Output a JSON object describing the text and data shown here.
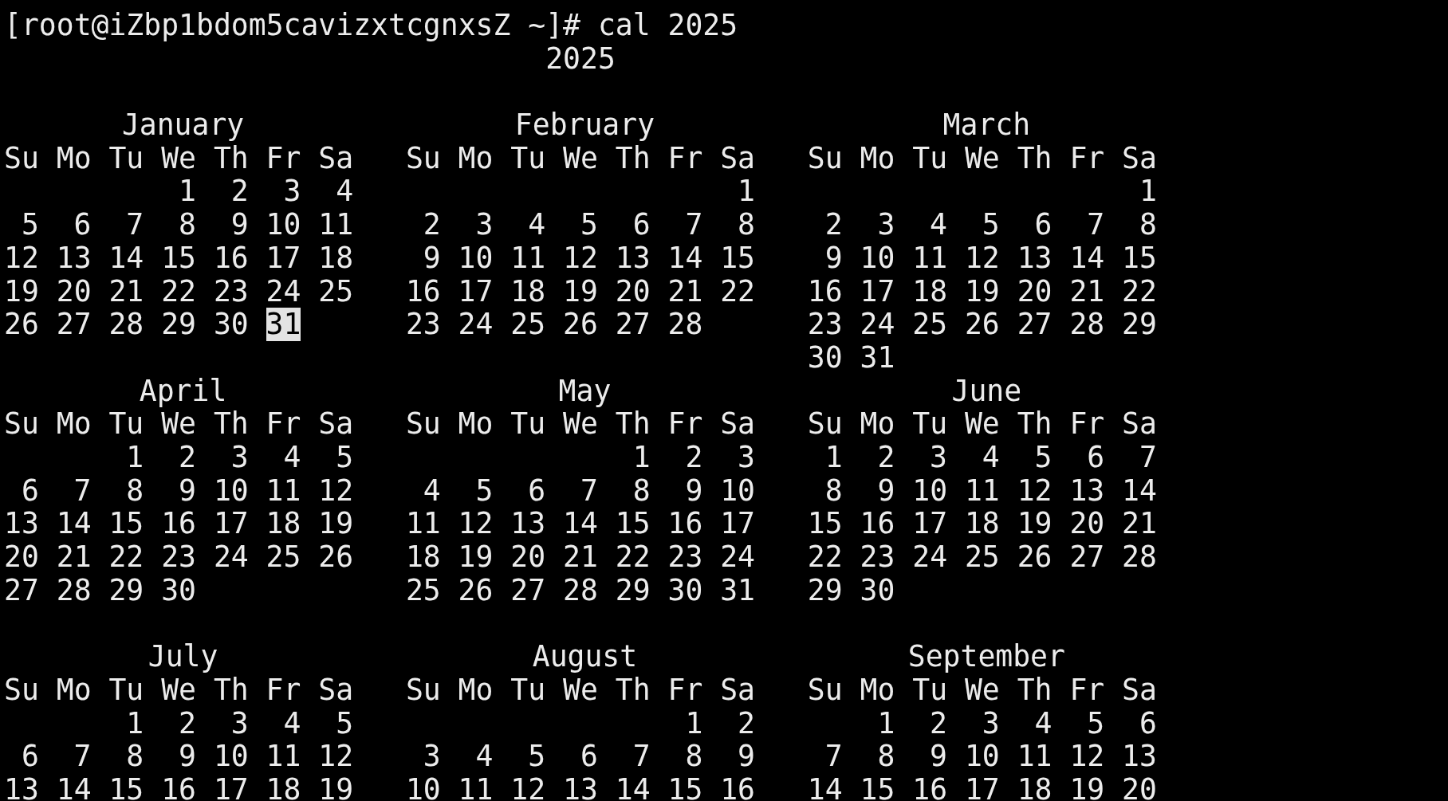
{
  "prompt": "[root@iZbp1bdom5cavizxtcgnxsZ ~]# cal 2025",
  "year": "2025",
  "months": [
    {
      "name": "January",
      "weekdays": [
        "Su",
        "Mo",
        "Tu",
        "We",
        "Th",
        "Fr",
        "Sa"
      ],
      "weeks": [
        [
          "1",
          "2",
          "3",
          "4"
        ],
        [
          "5",
          "6",
          "7",
          "8",
          "9",
          "10",
          "11"
        ],
        [
          "12",
          "13",
          "14",
          "15",
          "16",
          "17",
          "18"
        ],
        [
          "19",
          "20",
          "21",
          "22",
          "23",
          "24",
          "25"
        ],
        [
          "26",
          "27",
          "28",
          "29",
          "30",
          {
            "day": "31",
            "selected": true
          }
        ]
      ]
    },
    {
      "name": "February",
      "weekdays": [
        "Su",
        "Mo",
        "Tu",
        "We",
        "Th",
        "Fr",
        "Sa"
      ],
      "weeks": [
        [
          "1"
        ],
        [
          "2",
          "3",
          "4",
          "5",
          "6",
          "7",
          "8"
        ],
        [
          "9",
          "10",
          "11",
          "12",
          "13",
          "14",
          "15"
        ],
        [
          "16",
          "17",
          "18",
          "19",
          "20",
          "21",
          "22"
        ],
        [
          "23",
          "24",
          "25",
          "26",
          "27",
          "28"
        ]
      ]
    },
    {
      "name": "March",
      "weekdays": [
        "Su",
        "Mo",
        "Tu",
        "We",
        "Th",
        "Fr",
        "Sa"
      ],
      "weeks": [
        [
          "1"
        ],
        [
          "2",
          "3",
          "4",
          "5",
          "6",
          "7",
          "8"
        ],
        [
          "9",
          "10",
          "11",
          "12",
          "13",
          "14",
          "15"
        ],
        [
          "16",
          "17",
          "18",
          "19",
          "20",
          "21",
          "22"
        ],
        [
          "23",
          "24",
          "25",
          "26",
          "27",
          "28",
          "29"
        ],
        [
          "30",
          "31"
        ]
      ]
    },
    {
      "name": "April",
      "weekdays": [
        "Su",
        "Mo",
        "Tu",
        "We",
        "Th",
        "Fr",
        "Sa"
      ],
      "weeks": [
        [
          "1",
          "2",
          "3",
          "4",
          "5"
        ],
        [
          "6",
          "7",
          "8",
          "9",
          "10",
          "11",
          "12"
        ],
        [
          "13",
          "14",
          "15",
          "16",
          "17",
          "18",
          "19"
        ],
        [
          "20",
          "21",
          "22",
          "23",
          "24",
          "25",
          "26"
        ],
        [
          "27",
          "28",
          "29",
          "30"
        ]
      ]
    },
    {
      "name": "May",
      "weekdays": [
        "Su",
        "Mo",
        "Tu",
        "We",
        "Th",
        "Fr",
        "Sa"
      ],
      "weeks": [
        [
          "1",
          "2",
          "3"
        ],
        [
          "4",
          "5",
          "6",
          "7",
          "8",
          "9",
          "10"
        ],
        [
          "11",
          "12",
          "13",
          "14",
          "15",
          "16",
          "17"
        ],
        [
          "18",
          "19",
          "20",
          "21",
          "22",
          "23",
          "24"
        ],
        [
          "25",
          "26",
          "27",
          "28",
          "29",
          "30",
          "31"
        ]
      ]
    },
    {
      "name": "June",
      "weekdays": [
        "Su",
        "Mo",
        "Tu",
        "We",
        "Th",
        "Fr",
        "Sa"
      ],
      "weeks": [
        [
          "1",
          "2",
          "3",
          "4",
          "5",
          "6",
          "7"
        ],
        [
          "8",
          "9",
          "10",
          "11",
          "12",
          "13",
          "14"
        ],
        [
          "15",
          "16",
          "17",
          "18",
          "19",
          "20",
          "21"
        ],
        [
          "22",
          "23",
          "24",
          "25",
          "26",
          "27",
          "28"
        ],
        [
          "29",
          "30"
        ]
      ]
    },
    {
      "name": "July",
      "weekdays": [
        "Su",
        "Mo",
        "Tu",
        "We",
        "Th",
        "Fr",
        "Sa"
      ],
      "weeks": [
        [
          "1",
          "2",
          "3",
          "4",
          "5"
        ],
        [
          "6",
          "7",
          "8",
          "9",
          "10",
          "11",
          "12"
        ],
        [
          "13",
          "14",
          "15",
          "16",
          "17",
          "18",
          "19"
        ]
      ]
    },
    {
      "name": "August",
      "weekdays": [
        "Su",
        "Mo",
        "Tu",
        "We",
        "Th",
        "Fr",
        "Sa"
      ],
      "weeks": [
        [
          "1",
          "2"
        ],
        [
          "3",
          "4",
          "5",
          "6",
          "7",
          "8",
          "9"
        ],
        [
          "10",
          "11",
          "12",
          "13",
          "14",
          "15",
          "16"
        ]
      ]
    },
    {
      "name": "September",
      "weekdays": [
        "Su",
        "Mo",
        "Tu",
        "We",
        "Th",
        "Fr",
        "Sa"
      ],
      "weeks": [
        [
          "1",
          "2",
          "3",
          "4",
          "5",
          "6"
        ],
        [
          "7",
          "8",
          "9",
          "10",
          "11",
          "12",
          "13"
        ],
        [
          "14",
          "15",
          "16",
          "17",
          "18",
          "19",
          "20"
        ]
      ]
    }
  ]
}
